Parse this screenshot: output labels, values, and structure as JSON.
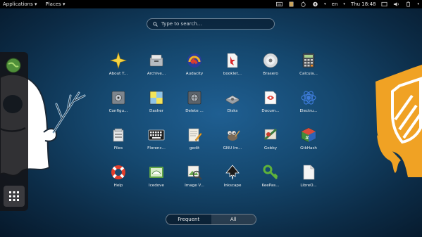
{
  "topbar": {
    "menus": [
      "Applications",
      "Places"
    ],
    "language": "en",
    "clock": "Thu 18:48"
  },
  "search": {
    "placeholder": "Type to search..."
  },
  "apps": [
    {
      "label": "About T...",
      "icon": "star-icon"
    },
    {
      "label": "Archive...",
      "icon": "archive-manager-icon"
    },
    {
      "label": "Audacity",
      "icon": "audacity-icon"
    },
    {
      "label": "booklet...",
      "icon": "booklet-icon"
    },
    {
      "label": "Brasero",
      "icon": "disc-burner-icon"
    },
    {
      "label": "Calcula...",
      "icon": "calculator-icon"
    },
    {
      "label": "Configu...",
      "icon": "safe-icon"
    },
    {
      "label": "Dasher",
      "icon": "dasher-icon"
    },
    {
      "label": "Delete ...",
      "icon": "vault-icon"
    },
    {
      "label": "Disks",
      "icon": "disks-icon"
    },
    {
      "label": "Docum...",
      "icon": "document-viewer-icon"
    },
    {
      "label": "Electru...",
      "icon": "bitcoin-icon"
    },
    {
      "label": "Files",
      "icon": "files-icon"
    },
    {
      "label": "Florenc...",
      "icon": "keyboard-icon"
    },
    {
      "label": "gedit",
      "icon": "text-editor-icon"
    },
    {
      "label": "GNU Im...",
      "icon": "gimp-icon"
    },
    {
      "label": "Gobby",
      "icon": "gobby-icon"
    },
    {
      "label": "GtkHash",
      "icon": "gtkhash-icon"
    },
    {
      "label": "Help",
      "icon": "lifebuoy-icon"
    },
    {
      "label": "Icedove",
      "icon": "mail-icon"
    },
    {
      "label": "Image V...",
      "icon": "image-viewer-icon"
    },
    {
      "label": "Inkscape",
      "icon": "inkscape-icon"
    },
    {
      "label": "KeePas...",
      "icon": "keepassx-icon"
    },
    {
      "label": "LibreO...",
      "icon": "libreoffice-icon"
    }
  ],
  "tabs": {
    "frequent": "Frequent",
    "all": "All"
  },
  "colors": {
    "accent": "#f0a224",
    "ghost": "#ffffff",
    "background": "#15486f"
  }
}
